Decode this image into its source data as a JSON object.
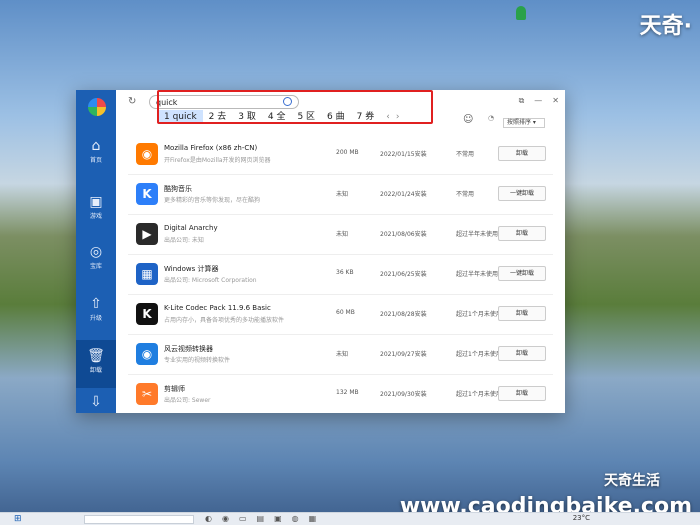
{
  "watermark": {
    "top": "天奇·",
    "mid": "天奇生活",
    "bottom": "www.caodingbaike.com"
  },
  "sidebar": {
    "items": [
      {
        "icon": "⌂",
        "label": "首页"
      },
      {
        "icon": "▣",
        "label": "游戏"
      },
      {
        "icon": "◎",
        "label": "宝库"
      },
      {
        "icon": "⇧",
        "label": "升级"
      },
      {
        "icon": "🗑",
        "label": "卸载"
      },
      {
        "icon": "⇩",
        "label": ""
      }
    ]
  },
  "search": {
    "value": "quick"
  },
  "ime": {
    "candidates": [
      "1 quick",
      "2 去",
      "3 取",
      "4 全",
      "5 区",
      "6 曲",
      "7 券"
    ],
    "prev": "‹",
    "next": "›"
  },
  "window_controls": {
    "restore": "⧉",
    "minimize": "—",
    "close": "✕"
  },
  "sort_label": "按照排序 ▾",
  "apps": [
    {
      "name": "Mozilla Firefox (x86 zh-CN)",
      "badge": "",
      "publisher": "开Firefox是由Mozilla开发的网页浏览器",
      "size": "200 MB",
      "date": "2022/01/15安装",
      "freq": "不常用",
      "action": "卸载",
      "icon_color": "#ff7a00",
      "icon_glyph": "◉"
    },
    {
      "name": "酷狗音乐",
      "badge": "",
      "publisher": "更多精彩的音乐等你发现，尽在酷狗",
      "size": "未知",
      "date": "2022/01/24安装",
      "freq": "不常用",
      "action": "一键卸载",
      "icon_color": "#2d7ff9",
      "icon_glyph": "K"
    },
    {
      "name": "Digital Anarchy",
      "badge": "",
      "publisher": "出品公司: 未知",
      "size": "未知",
      "date": "2021/08/06安装",
      "freq": "超过半年未使用",
      "action": "卸载",
      "icon_color": "#2a2a2a",
      "icon_glyph": "▶"
    },
    {
      "name": "Windows 计算器",
      "badge": "",
      "publisher": "出品公司: Microsoft Corporation",
      "size": "36 KB",
      "date": "2021/06/25安装",
      "freq": "超过半年未使用",
      "action": "一键卸载",
      "icon_color": "#1e63c6",
      "icon_glyph": "▦"
    },
    {
      "name": "K-Lite Codec Pack 11.9.6 Basic",
      "badge": "",
      "publisher": "占用内存小，具备各项优秀的多功能播放软件",
      "size": "60 MB",
      "date": "2021/08/28安装",
      "freq": "超过1个月未使用",
      "action": "卸载",
      "icon_color": "#111111",
      "icon_glyph": "K"
    },
    {
      "name": "风云视频转换器",
      "badge": "",
      "publisher": "专业实用的视频转换软件",
      "size": "未知",
      "date": "2021/09/27安装",
      "freq": "超过1个月未使用",
      "action": "卸载",
      "icon_color": "#1f7ee0",
      "icon_glyph": "◉"
    },
    {
      "name": "剪辑师",
      "badge": "",
      "publisher": "出品公司: Sewer",
      "size": "132 MB",
      "date": "2021/09/30安装",
      "freq": "超过1个月未使用",
      "action": "卸载",
      "icon_color": "#ff7a2a",
      "icon_glyph": "✂"
    }
  ],
  "taskbar": {
    "weather": "23°C"
  }
}
